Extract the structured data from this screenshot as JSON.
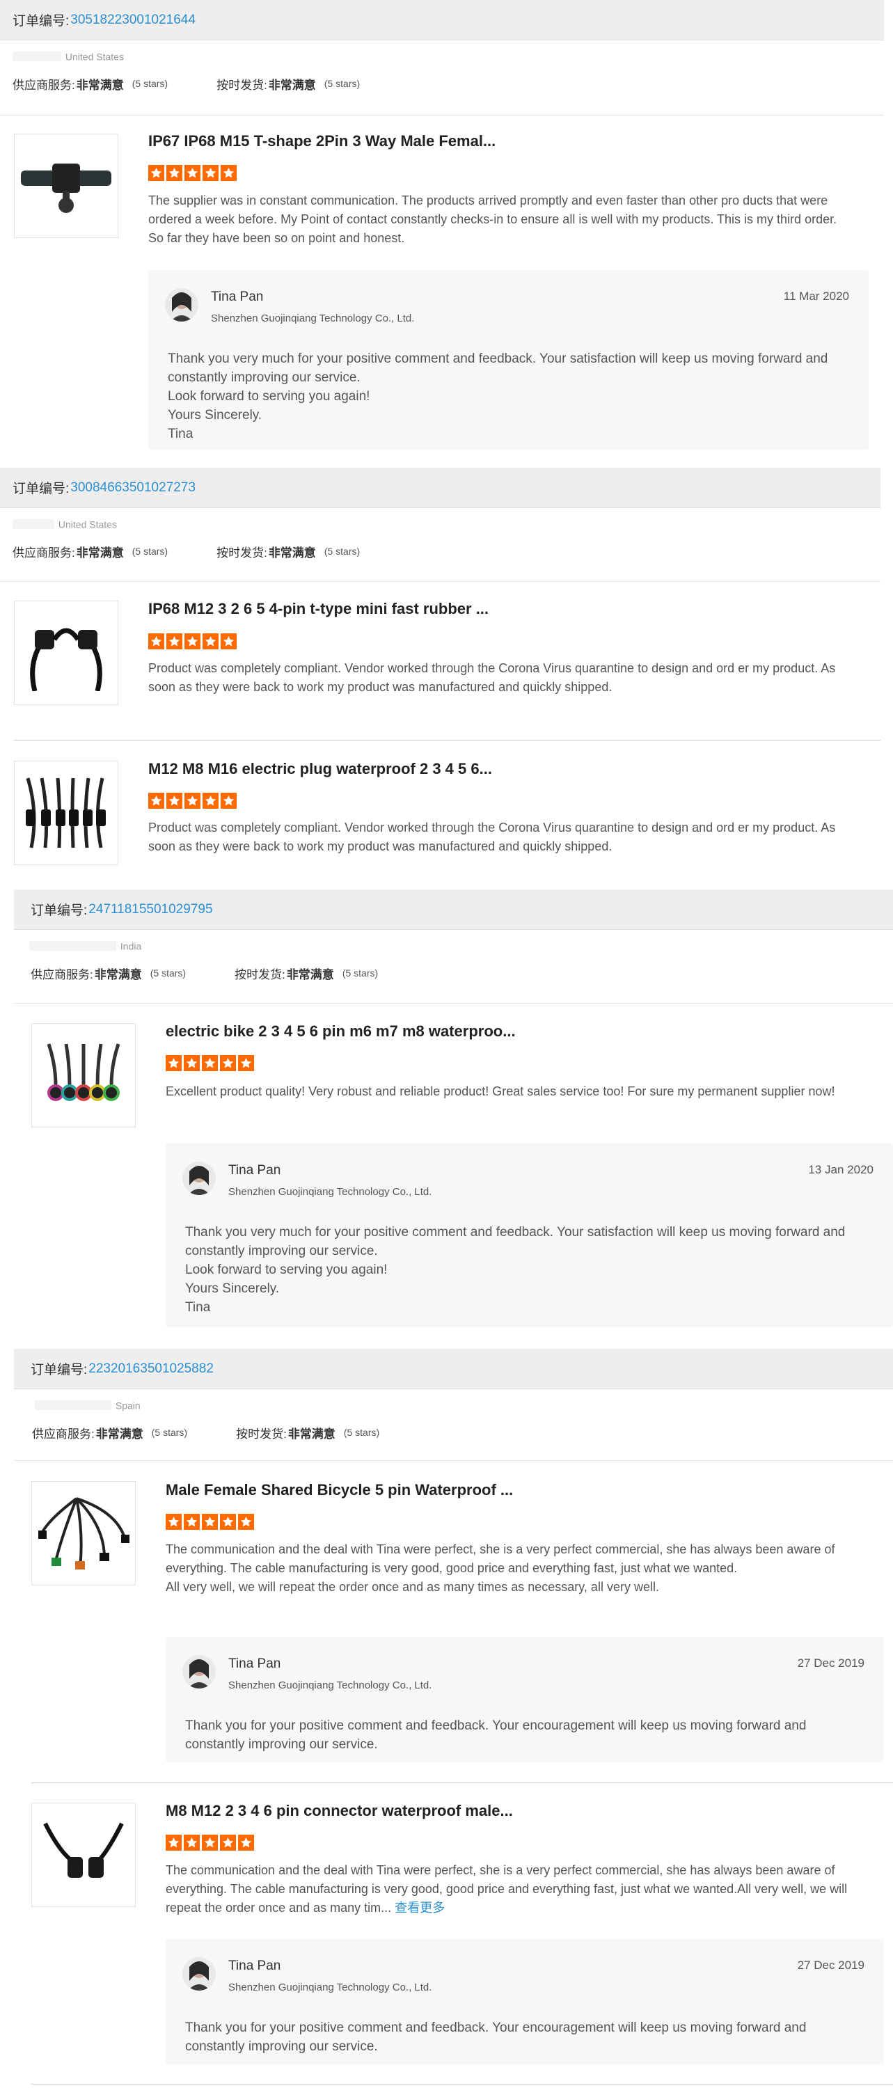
{
  "labels": {
    "order_id": "订单编号:",
    "supplier_service": "供应商服务:",
    "on_time_delivery": "按时发货:",
    "rating_value": "非常满意",
    "rating_stars": "(5 stars)"
  },
  "colors": {
    "accent": "#2b8fd1",
    "star": "#ff6a00",
    "header_bg": "#eeeeee",
    "reply_bg": "#f7f7f7"
  },
  "orders": [
    {
      "order_id": "3051822300102164​4",
      "country": "United States",
      "products": [
        {
          "title": "IP67 IP68 M15 T-shape 2Pin 3 Way Male Femal...",
          "thumb_icon": "t-connector-icon",
          "stars": 5,
          "review": "The supplier was in constant communication. The products arrived promptly and even faster than other pro ducts that were ordered a week before. My Point of contact constantly checks-in to ensure all is well with my products. This is my third order. So far they have been so on point and honest.",
          "reply": {
            "name": "Tina Pan",
            "company": "Shenzhen Guojinqiang Technology Co., Ltd.",
            "date": "11 Mar 2020",
            "body": "Thank you very much for your positive comment and feedback. Your satisfaction will keep us moving forward and constantly improving our service.\nLook forward to serving you again!\nYours Sincerely.\nTina"
          }
        }
      ]
    },
    {
      "order_id": "30084663501027273",
      "country": "United States",
      "products": [
        {
          "title": "IP68 M12 3 2 6 5 4-pin t-type mini fast rubber ...",
          "thumb_icon": "cable-connector-icon",
          "stars": 5,
          "review": "Product was completely compliant.  Vendor worked through the Corona Virus quarantine to design and ord er my product.  As soon as they were back to work my product was manufactured and quickly shipped."
        },
        {
          "title": "M12 M8 M16 electric plug waterproof 2 3 4 5 6...",
          "thumb_icon": "multi-plug-icon",
          "stars": 5,
          "review": "Product was completely compliant.  Vendor worked through the Corona Virus quarantine to design and ord er my product.  As soon as they were back to work my product was manufactured and quickly shipped."
        }
      ]
    },
    {
      "order_id": "24711815501029795",
      "country": "India",
      "products": [
        {
          "title": "electric bike 2 3 4 5 6 pin m6 m7 m8 waterproo...",
          "thumb_icon": "colored-connectors-icon",
          "stars": 5,
          "review": "Excellent product quality! Very robust and reliable product! Great sales service too! For sure my permanent supplier now!",
          "reply": {
            "name": "Tina Pan",
            "company": "Shenzhen Guojinqiang Technology Co., Ltd.",
            "date": "13 Jan 2020",
            "body": "Thank you very much for your positive comment and feedback. Your satisfaction will keep us moving forward and constantly improving our service.\nLook forward to serving you again!\nYours Sincerely.\nTina"
          }
        }
      ]
    },
    {
      "order_id": "22320163501025882",
      "country": "Spain",
      "products": [
        {
          "title": "Male Female Shared Bicycle 5 pin Waterproof ...",
          "thumb_icon": "bicycle-cable-icon",
          "stars": 5,
          "review": "The communication and the deal with Tina were perfect, she is a very perfect commercial, she has always been aware of everything. The cable manufacturing is very good, good price and everything fast, just what we wanted.\nAll very well, we will repeat the order once and as many times as necessary, all very well.",
          "reply": {
            "name": "Tina Pan",
            "company": "Shenzhen Guojinqiang Technology Co., Ltd.",
            "date": "27 Dec 2019",
            "body": "Thank you for your positive comment and feedback. Your encouragement will keep us moving forward and constantly improving our service."
          }
        },
        {
          "title": "M8 M12 2 3 4 6 pin connector waterproof male...",
          "thumb_icon": "pin-connector-icon",
          "stars": 5,
          "review": "The communication and the deal with Tina were perfect, she is a very perfect commercial, she has always been aware of everything. The cable manufacturing is very good, good price and everything fast, just what we wanted.All very well, we will repeat the order once and as many tim...",
          "more": "查看更多",
          "reply": {
            "name": "Tina Pan",
            "company": "Shenzhen Guojinqiang Technology Co., Ltd.",
            "date": "27 Dec 2019",
            "body": "Thank you for your positive comment and feedback. Your encouragement will keep us moving forward and constantly improving our service."
          }
        }
      ]
    }
  ]
}
